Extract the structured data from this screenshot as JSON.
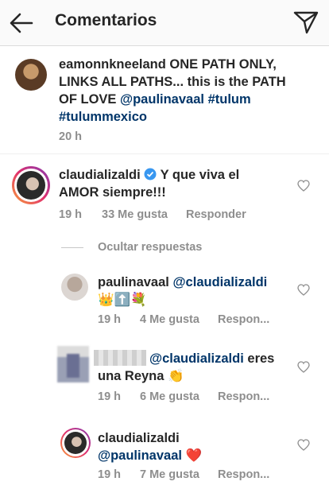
{
  "header": {
    "title": "Comentarios",
    "back_icon": "arrow-left-icon",
    "share_icon": "paper-plane-icon"
  },
  "caption": {
    "username": "eamonnkneeland",
    "text_lines": [
      "ONE PATH ONLY,",
      "LINKS ALL PATHS... this is the PATH",
      "OF LOVE"
    ],
    "mention": "@paulinavaal",
    "hashtag1": "#tulum",
    "hashtag2": "#tulummexico",
    "time": "20 h"
  },
  "comment": {
    "username": "claudializaldi",
    "text1": "Y que viva el",
    "text2": "AMOR siempre!!!",
    "time": "19 h",
    "likes": "33 Me gusta",
    "reply": "Responder"
  },
  "hide_replies": "Ocultar respuestas",
  "replies": [
    {
      "username": "paulinavaal",
      "mention": "@claudializaldi",
      "emoji": "👑⬆️💐",
      "time": "19 h",
      "likes": "4 Me gusta",
      "reply": "Respon..."
    },
    {
      "mention": "@claudializaldi",
      "text_after": "eres",
      "text2": "una Reyna",
      "emoji": "👏",
      "time": "19 h",
      "likes": "6 Me gusta",
      "reply": "Respon..."
    },
    {
      "username": "claudializaldi",
      "mention": "@paulinavaal",
      "emoji": "❤️",
      "time": "19 h",
      "likes": "7 Me gusta",
      "reply": "Respon..."
    }
  ],
  "colors": {
    "link": "#003569",
    "meta": "#8e8e8e",
    "verified": "#3897f0"
  }
}
